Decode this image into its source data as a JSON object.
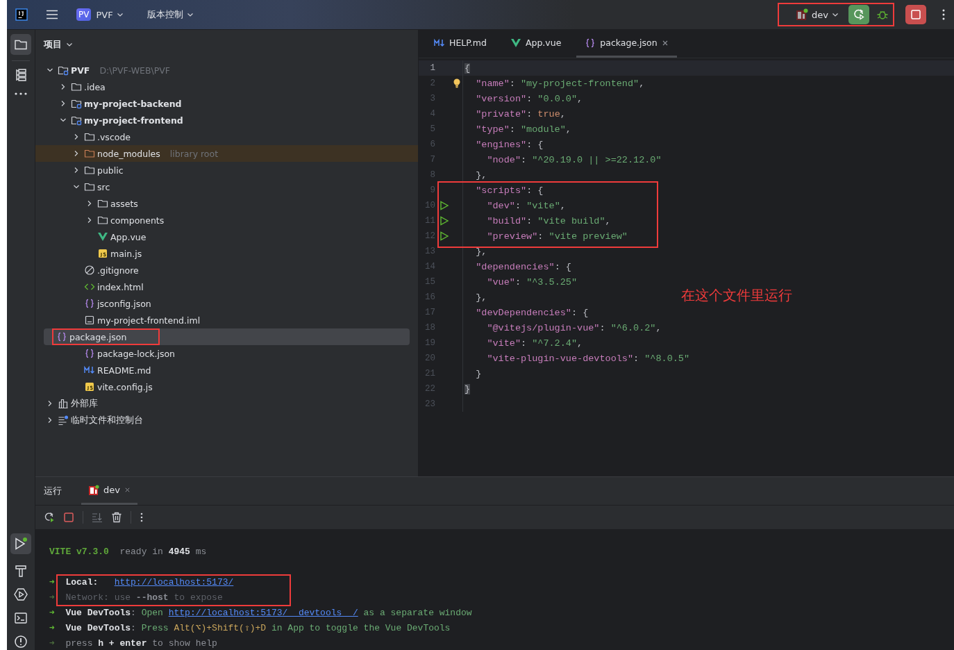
{
  "title_bar": {
    "project_badge": "PV",
    "project": "PVF",
    "vcs": "版本控制",
    "run_config": "dev",
    "run_config_annotated": true
  },
  "project_panel": {
    "title": "项目",
    "tree": [
      {
        "label": "PVF",
        "hint": "D:\\PVF-WEB\\PVF",
        "kind": "module",
        "expanded": true,
        "selected": false,
        "annotated": false,
        "children": [
          {
            "label": ".idea",
            "kind": "folder",
            "expanded": false,
            "selected": false,
            "annotated": false
          },
          {
            "label": "my-project-backend",
            "kind": "module",
            "expanded": false,
            "selected": false,
            "annotated": false
          },
          {
            "label": "my-project-frontend",
            "kind": "module",
            "expanded": true,
            "selected": false,
            "annotated": false,
            "children": [
              {
                "label": ".vscode",
                "kind": "folder",
                "expanded": false,
                "selected": false,
                "annotated": false
              },
              {
                "label": "node_modules",
                "hint": "library root",
                "kind": "library",
                "expanded": false,
                "selected": false,
                "annotated": false
              },
              {
                "label": "public",
                "kind": "folder",
                "expanded": false,
                "selected": false,
                "annotated": false
              },
              {
                "label": "src",
                "kind": "folder",
                "expanded": true,
                "selected": false,
                "annotated": false,
                "children": [
                  {
                    "label": "assets",
                    "kind": "folder",
                    "expanded": false,
                    "selected": false,
                    "annotated": false
                  },
                  {
                    "label": "components",
                    "kind": "folder",
                    "expanded": false,
                    "selected": false,
                    "annotated": false
                  },
                  {
                    "label": "App.vue",
                    "kind": "vue",
                    "selected": false,
                    "annotated": false
                  },
                  {
                    "label": "main.js",
                    "kind": "js",
                    "selected": false,
                    "annotated": false
                  }
                ]
              },
              {
                "label": ".gitignore",
                "kind": "ignore",
                "selected": false,
                "annotated": false
              },
              {
                "label": "index.html",
                "kind": "html",
                "selected": false,
                "annotated": false
              },
              {
                "label": "jsconfig.json",
                "kind": "json",
                "selected": false,
                "annotated": false
              },
              {
                "label": "my-project-frontend.iml",
                "kind": "iml",
                "selected": false,
                "annotated": false
              },
              {
                "label": "package.json",
                "kind": "json",
                "selected": true,
                "annotated": true
              },
              {
                "label": "package-lock.json",
                "kind": "json",
                "selected": false,
                "annotated": false
              },
              {
                "label": "README.md",
                "kind": "md",
                "selected": false,
                "annotated": false
              },
              {
                "label": "vite.config.js",
                "kind": "js",
                "selected": false,
                "annotated": false
              }
            ]
          }
        ]
      },
      {
        "label": "外部库",
        "kind": "libraries",
        "expanded": false,
        "selected": false,
        "annotated": false
      },
      {
        "label": "临时文件和控制台",
        "kind": "scratch",
        "expanded": false,
        "selected": false,
        "annotated": false
      }
    ]
  },
  "editor": {
    "tabs": [
      {
        "label": "HELP.md",
        "kind": "md",
        "selected": false
      },
      {
        "label": "App.vue",
        "kind": "vue",
        "selected": false
      },
      {
        "label": "package.json",
        "kind": "json",
        "selected": true
      }
    ],
    "lines": [
      {
        "n": "1",
        "current": true,
        "bulb": false,
        "run": false,
        "boxed": false,
        "tokens": [
          {
            "kind": "brace",
            "text": "{"
          }
        ]
      },
      {
        "n": "2",
        "current": false,
        "bulb": true,
        "run": false,
        "boxed": false,
        "tokens": [
          {
            "kind": "key",
            "text": "  \"name\""
          },
          {
            "kind": "punct",
            "text": ": "
          },
          {
            "kind": "string",
            "text": "\"my-project-frontend\""
          },
          {
            "kind": "punct",
            "text": ","
          }
        ]
      },
      {
        "n": "3",
        "current": false,
        "bulb": false,
        "run": false,
        "boxed": false,
        "tokens": [
          {
            "kind": "key",
            "text": "  \"version\""
          },
          {
            "kind": "punct",
            "text": ": "
          },
          {
            "kind": "string",
            "text": "\"0.0.0\""
          },
          {
            "kind": "punct",
            "text": ","
          }
        ]
      },
      {
        "n": "4",
        "current": false,
        "bulb": false,
        "run": false,
        "boxed": false,
        "tokens": [
          {
            "kind": "key",
            "text": "  \"private\""
          },
          {
            "kind": "punct",
            "text": ": "
          },
          {
            "kind": "keyword",
            "text": "true"
          },
          {
            "kind": "punct",
            "text": ","
          }
        ]
      },
      {
        "n": "5",
        "current": false,
        "bulb": false,
        "run": false,
        "boxed": false,
        "tokens": [
          {
            "kind": "key",
            "text": "  \"type\""
          },
          {
            "kind": "punct",
            "text": ": "
          },
          {
            "kind": "string",
            "text": "\"module\""
          },
          {
            "kind": "punct",
            "text": ","
          }
        ]
      },
      {
        "n": "6",
        "current": false,
        "bulb": false,
        "run": false,
        "boxed": false,
        "tokens": [
          {
            "kind": "key",
            "text": "  \"engines\""
          },
          {
            "kind": "punct",
            "text": ": {"
          }
        ]
      },
      {
        "n": "7",
        "current": false,
        "bulb": false,
        "run": false,
        "boxed": false,
        "tokens": [
          {
            "kind": "key",
            "text": "    \"node\""
          },
          {
            "kind": "punct",
            "text": ": "
          },
          {
            "kind": "string",
            "text": "\"^20.19.0 || >=22.12.0\""
          }
        ]
      },
      {
        "n": "8",
        "current": false,
        "bulb": false,
        "run": false,
        "boxed": false,
        "tokens": [
          {
            "kind": "punct",
            "text": "  },"
          }
        ]
      },
      {
        "n": "9",
        "current": false,
        "bulb": false,
        "run": false,
        "boxed": true,
        "tokens": [
          {
            "kind": "key",
            "text": "  \"scripts\""
          },
          {
            "kind": "punct",
            "text": ": {"
          }
        ]
      },
      {
        "n": "10",
        "current": false,
        "bulb": false,
        "run": true,
        "boxed": true,
        "tokens": [
          {
            "kind": "key",
            "text": "    \"dev\""
          },
          {
            "kind": "punct",
            "text": ": "
          },
          {
            "kind": "string",
            "text": "\"vite\""
          },
          {
            "kind": "punct",
            "text": ","
          }
        ]
      },
      {
        "n": "11",
        "current": false,
        "bulb": false,
        "run": true,
        "boxed": true,
        "tokens": [
          {
            "kind": "key",
            "text": "    \"build\""
          },
          {
            "kind": "punct",
            "text": ": "
          },
          {
            "kind": "string",
            "text": "\"vite build\""
          },
          {
            "kind": "punct",
            "text": ","
          }
        ]
      },
      {
        "n": "12",
        "current": false,
        "bulb": false,
        "run": true,
        "boxed": true,
        "tokens": [
          {
            "kind": "key",
            "text": "    \"preview\""
          },
          {
            "kind": "punct",
            "text": ": "
          },
          {
            "kind": "string",
            "text": "\"vite preview\""
          }
        ]
      },
      {
        "n": "13",
        "current": false,
        "bulb": false,
        "run": false,
        "boxed": false,
        "tokens": [
          {
            "kind": "punct",
            "text": "  },"
          }
        ]
      },
      {
        "n": "14",
        "current": false,
        "bulb": false,
        "run": false,
        "boxed": false,
        "tokens": [
          {
            "kind": "key",
            "text": "  \"dependencies\""
          },
          {
            "kind": "punct",
            "text": ": {"
          }
        ]
      },
      {
        "n": "15",
        "current": false,
        "bulb": false,
        "run": false,
        "boxed": false,
        "tokens": [
          {
            "kind": "key",
            "text": "    \"vue\""
          },
          {
            "kind": "punct",
            "text": ": "
          },
          {
            "kind": "string",
            "text": "\"^3.5.25\""
          }
        ]
      },
      {
        "n": "16",
        "current": false,
        "bulb": false,
        "run": false,
        "boxed": false,
        "tokens": [
          {
            "kind": "punct",
            "text": "  },"
          }
        ]
      },
      {
        "n": "17",
        "current": false,
        "bulb": false,
        "run": false,
        "boxed": false,
        "tokens": [
          {
            "kind": "key",
            "text": "  \"devDependencies\""
          },
          {
            "kind": "punct",
            "text": ": {"
          }
        ]
      },
      {
        "n": "18",
        "current": false,
        "bulb": false,
        "run": false,
        "boxed": false,
        "tokens": [
          {
            "kind": "key",
            "text": "    \"@vitejs/plugin-vue\""
          },
          {
            "kind": "punct",
            "text": ": "
          },
          {
            "kind": "string",
            "text": "\"^6.0.2\""
          },
          {
            "kind": "punct",
            "text": ","
          }
        ]
      },
      {
        "n": "19",
        "current": false,
        "bulb": false,
        "run": false,
        "boxed": false,
        "tokens": [
          {
            "kind": "key",
            "text": "    \"vite\""
          },
          {
            "kind": "punct",
            "text": ": "
          },
          {
            "kind": "string",
            "text": "\"^7.2.4\""
          },
          {
            "kind": "punct",
            "text": ","
          }
        ]
      },
      {
        "n": "20",
        "current": false,
        "bulb": false,
        "run": false,
        "boxed": false,
        "tokens": [
          {
            "kind": "key",
            "text": "    \"vite-plugin-vue-devtools\""
          },
          {
            "kind": "punct",
            "text": ": "
          },
          {
            "kind": "string",
            "text": "\"^8.0.5\""
          }
        ]
      },
      {
        "n": "21",
        "current": false,
        "bulb": false,
        "run": false,
        "boxed": false,
        "tokens": [
          {
            "kind": "punct",
            "text": "  }"
          }
        ]
      },
      {
        "n": "22",
        "current": false,
        "bulb": false,
        "run": false,
        "boxed": false,
        "tokens": [
          {
            "kind": "brace",
            "text": "}"
          }
        ]
      },
      {
        "n": "23",
        "current": false,
        "bulb": false,
        "run": false,
        "boxed": false
      }
    ],
    "note": "在这个文件里运行"
  },
  "run_panel": {
    "title": "运行",
    "tabs": [
      {
        "label": "dev",
        "selected": true
      }
    ],
    "console": [
      {
        "boxed": false,
        "tokens": [
          {
            "kind": "vite",
            "text": "VITE v7.3.0"
          },
          {
            "kind": "gray",
            "text": "  ready in "
          },
          {
            "kind": "bold",
            "text": "4945"
          },
          {
            "kind": "gray",
            "text": " ms"
          }
        ]
      },
      {
        "boxed": false
      },
      {
        "boxed": true,
        "tokens": [
          {
            "kind": "arrow",
            "text": "➜"
          },
          {
            "kind": "bold",
            "text": "  Local:   "
          },
          {
            "kind": "link",
            "text": "http://localhost:5173/"
          }
        ]
      },
      {
        "boxed": true,
        "tokens": [
          {
            "kind": "dimarrow",
            "text": "➜"
          },
          {
            "kind": "dim",
            "text": "  Network: use "
          },
          {
            "kind": "dimbold",
            "text": "--host"
          },
          {
            "kind": "dim",
            "text": " to expose"
          }
        ]
      },
      {
        "boxed": false,
        "tokens": [
          {
            "kind": "arrow",
            "text": "➜"
          },
          {
            "kind": "bold",
            "text": "  Vue DevTools"
          },
          {
            "kind": "gray",
            "text": ": "
          },
          {
            "kind": "green",
            "text": "Open "
          },
          {
            "kind": "link",
            "text": "http://localhost:5173/__devtools__/"
          },
          {
            "kind": "green",
            "text": " as a separate window"
          }
        ]
      },
      {
        "boxed": false,
        "tokens": [
          {
            "kind": "arrow",
            "text": "➜"
          },
          {
            "kind": "bold",
            "text": "  Vue DevTools"
          },
          {
            "kind": "gray",
            "text": ": "
          },
          {
            "kind": "green",
            "text": "Press "
          },
          {
            "kind": "yellow",
            "text": "Alt(⌥)+Shift(⇧)+D"
          },
          {
            "kind": "green",
            "text": " in App to toggle the Vue DevTools"
          }
        ]
      },
      {
        "boxed": false,
        "tokens": [
          {
            "kind": "dimarrow",
            "text": "➜"
          },
          {
            "kind": "gray",
            "text": "  press "
          },
          {
            "kind": "bold",
            "text": "h + enter"
          },
          {
            "kind": "gray",
            "text": " to show help"
          }
        ]
      }
    ]
  }
}
